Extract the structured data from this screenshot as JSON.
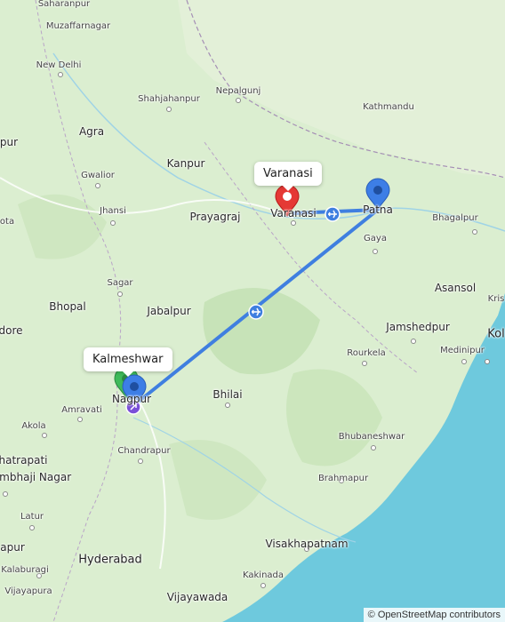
{
  "map": {
    "labels": [
      {
        "text": "Saharanpur",
        "size": "sm"
      },
      {
        "text": "Muzaffarnagar",
        "size": "sm"
      },
      {
        "text": "New Delhi",
        "size": "sm"
      },
      {
        "text": "Shahjahanpur",
        "size": "sm"
      },
      {
        "text": "Nepalgunj",
        "size": "sm"
      },
      {
        "text": "Kathmandu",
        "size": "sm"
      },
      {
        "text": "Agra",
        "size": "med"
      },
      {
        "text": "Kanpur",
        "size": "med"
      },
      {
        "text": "Gwalior",
        "size": "sm"
      },
      {
        "text": "Jhansi",
        "size": "sm"
      },
      {
        "text": "Prayagraj",
        "size": "med"
      },
      {
        "text": "Varanasi",
        "size": "med"
      },
      {
        "text": "Patna",
        "size": "med"
      },
      {
        "text": "Bhagalpur",
        "size": "sm"
      },
      {
        "text": "Gaya",
        "size": "sm"
      },
      {
        "text": "Sagar",
        "size": "sm"
      },
      {
        "text": "Asansol",
        "size": "med"
      },
      {
        "text": "Bhopal",
        "size": "med"
      },
      {
        "text": "Jabalpur",
        "size": "med"
      },
      {
        "text": "Jamshedpur",
        "size": "med"
      },
      {
        "text": "Rourkela",
        "size": "sm"
      },
      {
        "text": "Medinipur",
        "size": "sm"
      },
      {
        "text": "Nagpur",
        "size": "med"
      },
      {
        "text": "Amravati",
        "size": "sm"
      },
      {
        "text": "Bhilai",
        "size": "med"
      },
      {
        "text": "Akola",
        "size": "sm"
      },
      {
        "text": "Chandrapur",
        "size": "sm"
      },
      {
        "text": "Bhubaneshwar",
        "size": "sm"
      },
      {
        "text": "Brahmapur",
        "size": "sm"
      },
      {
        "text": "Visakhapatnam",
        "size": "med"
      },
      {
        "text": "Kakinada",
        "size": "sm"
      },
      {
        "text": "Hyderabad",
        "size": "big"
      },
      {
        "text": "Vijayawada",
        "size": "med"
      },
      {
        "text": "Latur",
        "size": "sm"
      },
      {
        "text": "Kalaburagi",
        "size": "sm"
      },
      {
        "text": "Vijayapura",
        "size": "sm"
      },
      {
        "text": "pur",
        "size": "med"
      },
      {
        "text": "ota",
        "size": "sm"
      },
      {
        "text": "dore",
        "size": "med"
      },
      {
        "text": "hatrapati",
        "size": "med"
      },
      {
        "text": "ambhaji Nagar",
        "size": "med"
      },
      {
        "text": "apur",
        "size": "med"
      },
      {
        "text": "Kris",
        "size": "sm"
      },
      {
        "text": "Kol",
        "size": "big"
      }
    ],
    "callouts": [
      {
        "text": "Varanasi"
      },
      {
        "text": "Kalmeshwar"
      }
    ],
    "colors": {
      "land": "#dbeed0",
      "water": "#6ec9dd",
      "route": "#3f7fe0",
      "pin_blue": "#3d7ee6",
      "pin_red": "#e53935",
      "pin_green": "#3fba5a",
      "pin_purple": "#7a4fd8"
    },
    "route_icons": [
      "plane-icon",
      "plane-icon"
    ],
    "attribution": "© OpenStreetMap contributors"
  }
}
